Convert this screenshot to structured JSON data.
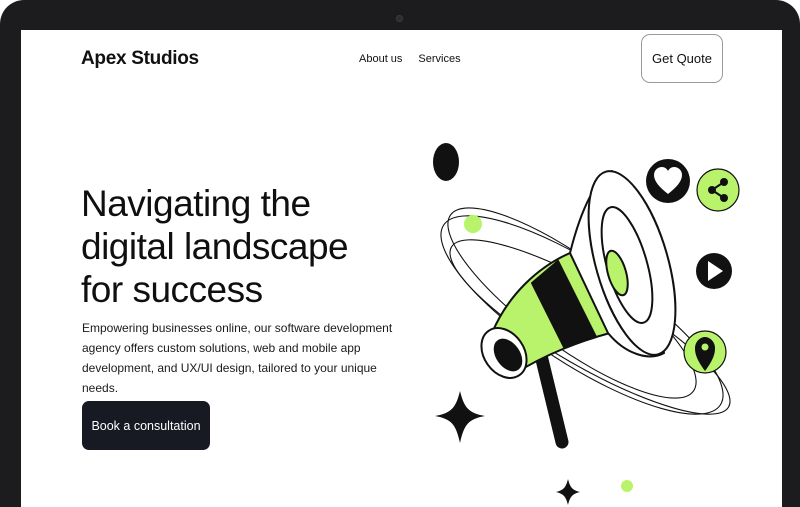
{
  "brand": {
    "name": "Apex Studios"
  },
  "nav": {
    "items": [
      {
        "label": "About us"
      },
      {
        "label": "Services"
      }
    ]
  },
  "header": {
    "quote_label": "Get Quote"
  },
  "hero": {
    "title_lines": [
      "Navigating the",
      "digital landscape",
      "for success"
    ],
    "description": "Empowering businesses online, our software development agency offers custom solutions, web and mobile app development, and UX/UI design, tailored to your unique needs.",
    "cta_label": "Book a consultation"
  },
  "colors": {
    "accent": "#b8f36b",
    "dark": "#111111",
    "button_dark": "#171923",
    "frame": "#1c1c1e"
  },
  "icons": [
    "megaphone-icon",
    "heart-icon",
    "share-icon",
    "play-icon",
    "location-pin-icon",
    "sparkle-icon"
  ]
}
